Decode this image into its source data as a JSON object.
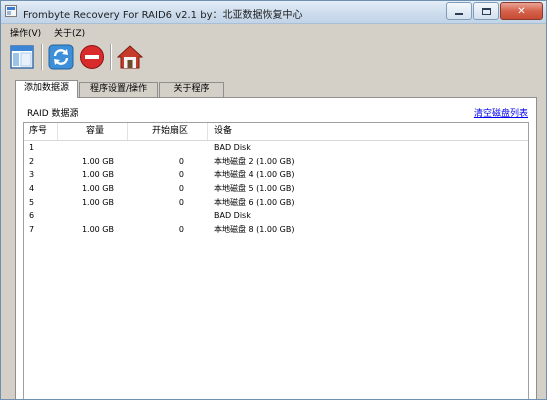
{
  "window": {
    "title": "Frombyte Recovery For RAID6 v2.1 by：北亚数据恢复中心",
    "close_glyph": "✕"
  },
  "menu": {
    "items": [
      {
        "label": "操作(V)"
      },
      {
        "label": "关于(Z)"
      }
    ]
  },
  "toolbar": {
    "buttons": [
      "window-icon",
      "refresh-icon",
      "stop-icon",
      "home-icon"
    ]
  },
  "tabs": [
    {
      "label": "添加数据源",
      "active": true
    },
    {
      "label": "程序设置/操作",
      "active": false
    },
    {
      "label": "关于程序",
      "active": false
    }
  ],
  "panel": {
    "label": "RAID 数据源",
    "clear_link": "清空磁盘列表"
  },
  "list": {
    "columns": [
      "序号",
      "容量",
      "开始扇区",
      "设备"
    ],
    "rows": [
      {
        "idx": "1",
        "size": "",
        "start": "",
        "device": "BAD Disk"
      },
      {
        "idx": "2",
        "size": "1.00 GB",
        "start": "0",
        "device": "本地磁盘 2 (1.00 GB)"
      },
      {
        "idx": "3",
        "size": "1.00 GB",
        "start": "0",
        "device": "本地磁盘 4 (1.00 GB)"
      },
      {
        "idx": "4",
        "size": "1.00 GB",
        "start": "0",
        "device": "本地磁盘 5 (1.00 GB)"
      },
      {
        "idx": "5",
        "size": "1.00 GB",
        "start": "0",
        "device": "本地磁盘 6 (1.00 GB)"
      },
      {
        "idx": "6",
        "size": "",
        "start": "",
        "device": "BAD Disk"
      },
      {
        "idx": "7",
        "size": "1.00 GB",
        "start": "0",
        "device": "本地磁盘 8 (1.00 GB)"
      }
    ]
  },
  "colors": {
    "link": "#0000ee",
    "window_bg": "#d4d0c8",
    "close_button": "#c64a33"
  }
}
